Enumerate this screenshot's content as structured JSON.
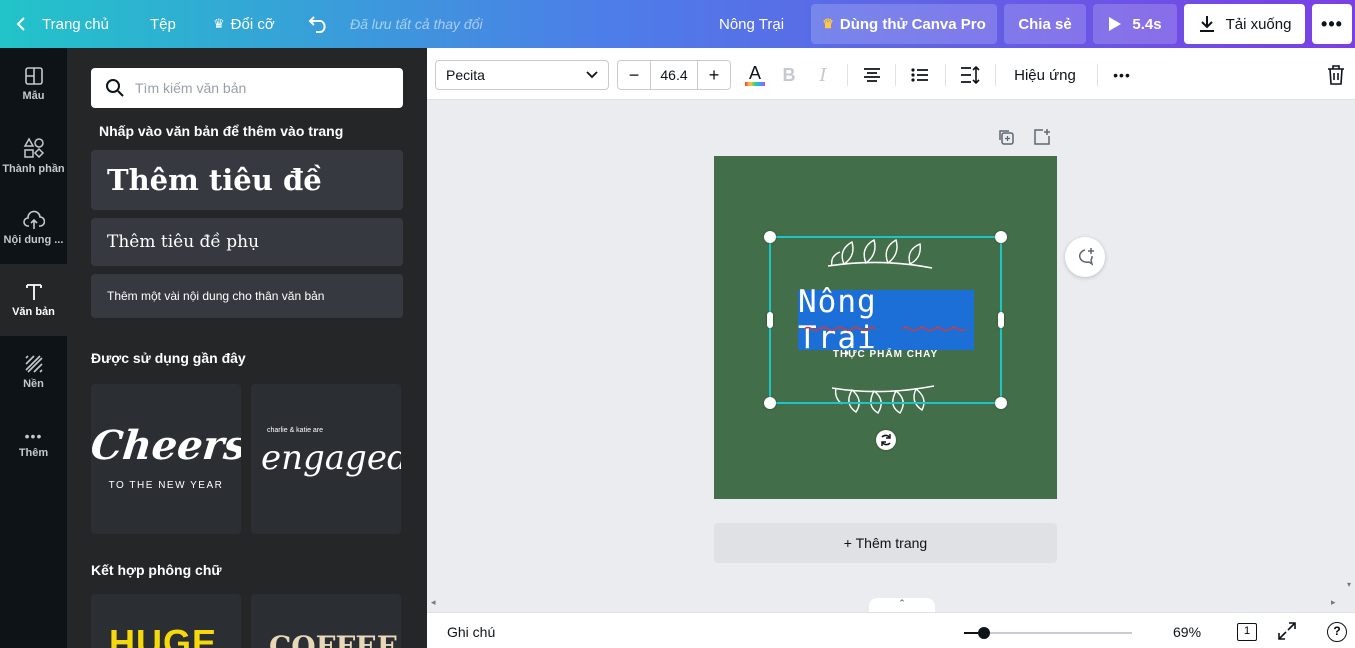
{
  "topbar": {
    "home_label": "Trang chủ",
    "file_label": "Tệp",
    "resize_label": "Đổi cỡ",
    "save_status": "Đã lưu tất cả thay đổi",
    "doc_title": "Nông Trại",
    "try_pro_label": "Dùng thử Canva Pro",
    "share_label": "Chia sẻ",
    "play_label": "5.4s",
    "download_label": "Tải xuống"
  },
  "rail": {
    "items": [
      {
        "label": "Mẫu",
        "icon": "template-icon"
      },
      {
        "label": "Thành phần",
        "icon": "elements-icon"
      },
      {
        "label": "Nội dung ...",
        "icon": "upload-icon"
      },
      {
        "label": "Văn bản",
        "icon": "text-icon"
      },
      {
        "label": "Nền",
        "icon": "background-icon"
      },
      {
        "label": "Thêm",
        "icon": "more-icon"
      }
    ]
  },
  "panel": {
    "search_placeholder": "Tìm kiếm văn bản",
    "click_hint": "Nhấp vào văn bản để thêm vào trang",
    "add_heading": "Thêm tiêu đề",
    "add_subheading": "Thêm tiêu đề phụ",
    "add_body": "Thêm một vài nội dung cho thân văn bản",
    "recent_heading": "Được sử dụng gần đây",
    "recent_items": [
      {
        "main": "Cheers",
        "sub": "TO THE NEW YEAR"
      },
      {
        "top": "charlie & katie are",
        "main": "engaged!"
      }
    ],
    "combo_heading": "Kết hợp phông chữ",
    "combo_items": [
      "HUGE",
      "COFFEE"
    ]
  },
  "toolbar": {
    "font_name": "Pecita",
    "font_size": "46.4",
    "effects_label": "Hiệu ứng"
  },
  "canvas": {
    "title_text": "Nông Trại",
    "subtitle_text": "THỰC PHẨM CHAY",
    "add_page_label": "+ Thêm trang"
  },
  "bottom": {
    "notes_label": "Ghi chú",
    "zoom": "69%",
    "page_count": "1"
  },
  "colors": {
    "artboard": "#436e4a",
    "selection": "#1fc4c7",
    "text_highlight": "#1b6fd6",
    "pro_button": "#7d5ce8",
    "gradient_start": "#22c4c9",
    "gradient_end": "#7b3fe4"
  }
}
